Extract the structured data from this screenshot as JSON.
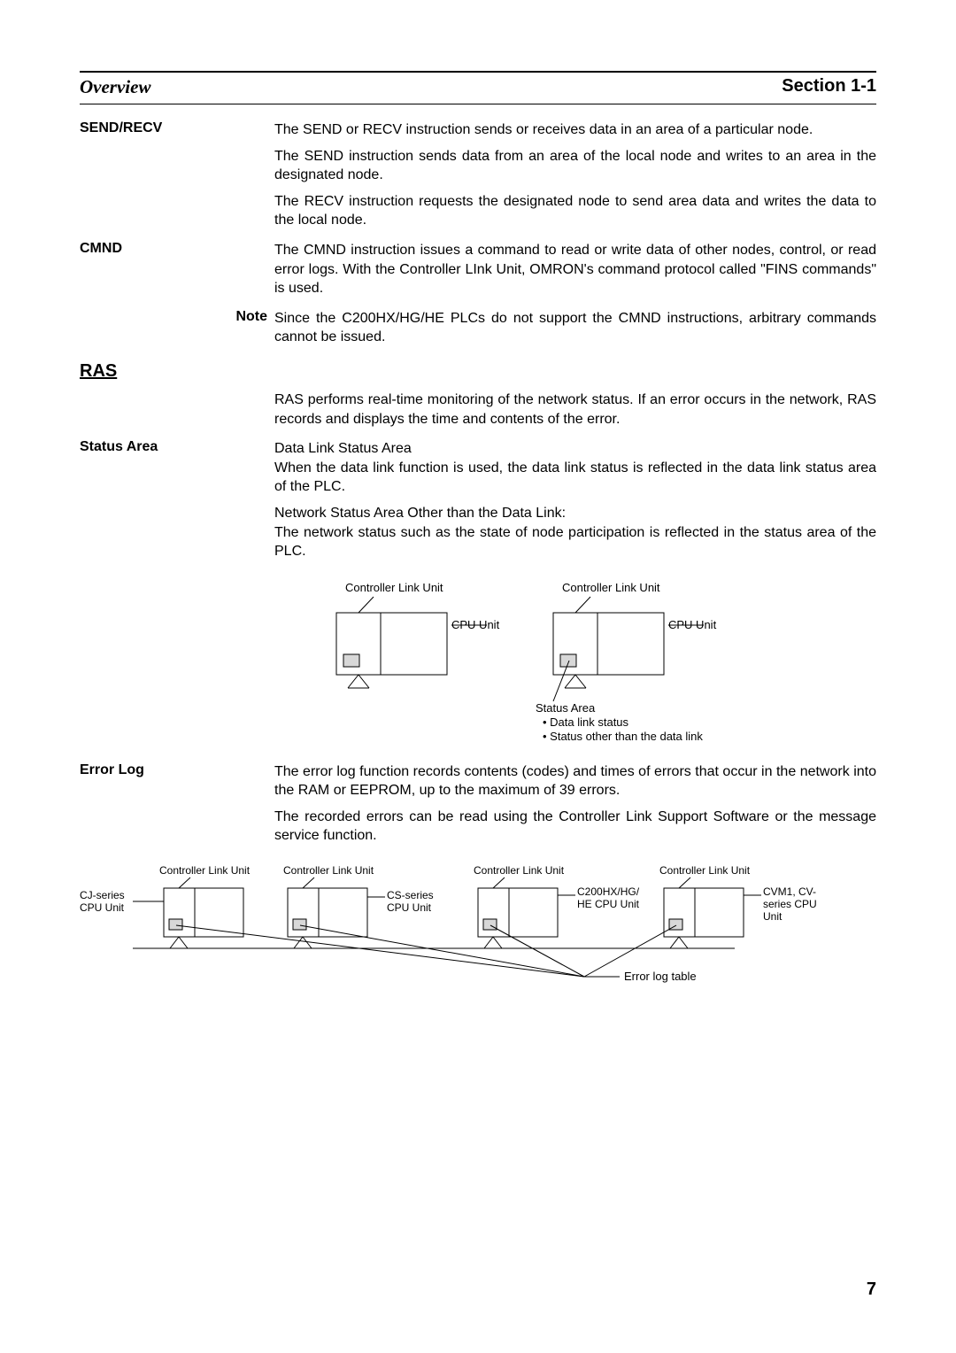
{
  "header": {
    "left": "Overview",
    "right": "Section 1-1"
  },
  "sendrecv": {
    "label": "SEND/RECV",
    "p1": "The SEND or RECV instruction sends or receives data in an area of a particular node.",
    "p2": "The SEND instruction sends data from an area of the local node and writes to an area in the designated node.",
    "p3": "The RECV instruction requests the designated node to send area data and writes the data to the local node."
  },
  "cmnd": {
    "label": "CMND",
    "p1": "The CMND instruction issues a command to read or write data of other nodes, control, or read error logs. With the Controller LInk Unit, OMRON's command protocol called \"FINS commands\" is used."
  },
  "note": {
    "label": "Note",
    "p1": "Since the C200HX/HG/HE PLCs do not support the CMND instructions, arbitrary commands cannot be issued."
  },
  "ras": {
    "head": "RAS",
    "p1": "RAS performs real-time monitoring of the network status. If an error occurs in the network, RAS records and displays the time and contents of the error."
  },
  "status": {
    "label": "Status Area",
    "p1a": "Data Link Status Area",
    "p1b": "When the data link function is used, the data link status is reflected in the data link status area of the PLC.",
    "p2a": "Network Status Area Other than the Data Link:",
    "p2b": "The network status such as the state of node participation is reflected in the status area of the PLC."
  },
  "diag1": {
    "clu": "Controller Link Unit",
    "cpu": "CPU Unit",
    "sa_title": "Status Area",
    "sa_b1": "Data link status",
    "sa_b2": "Status other than the data link"
  },
  "errorlog": {
    "label": "Error Log",
    "p1": "The error log function records contents (codes) and times of errors that occur in the network into the RAM or EEPROM, up to the maximum of 39 errors.",
    "p2": "The recorded errors can be read using the Controller Link Support Software or the message service function."
  },
  "diag2": {
    "clu": "Controller Link Unit",
    "cj": "CJ-series CPU Unit",
    "cs": "CS-series CPU Unit",
    "c200": "C200HX/HG/HE CPU Unit",
    "cvm1": "CVM1, CV-series CPU Unit",
    "elt": "Error log table"
  },
  "page": "7"
}
